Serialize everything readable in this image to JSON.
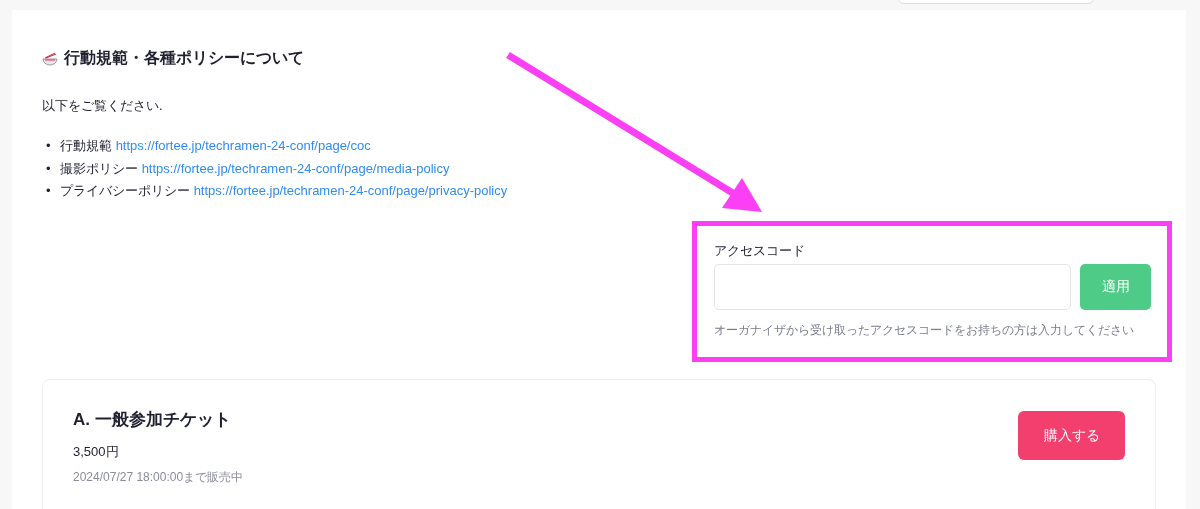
{
  "section": {
    "title": "行動規範・各種ポリシーについて",
    "intro": "以下をご覧ください.",
    "links": [
      {
        "bullet": "•",
        "label": "行動規範",
        "url": "https://fortee.jp/techramen-24-conf/page/coc"
      },
      {
        "bullet": "•",
        "label": "撮影ポリシー",
        "url": "https://fortee.jp/techramen-24-conf/page/media-policy"
      },
      {
        "bullet": "•",
        "label": "プライバシーポリシー",
        "url": "https://fortee.jp/techramen-24-conf/page/privacy-policy"
      }
    ]
  },
  "access_code": {
    "label": "アクセスコード",
    "button": "適用",
    "help": "オーガナイザから受け取ったアクセスコードをお持ちの方は入力してください",
    "highlighted": true
  },
  "tickets": [
    {
      "title": "A. 一般参加チケット",
      "price": "3,500円",
      "sale_until": "2024/07/27 18:00:00まで販売中",
      "button": "購入する"
    }
  ]
}
